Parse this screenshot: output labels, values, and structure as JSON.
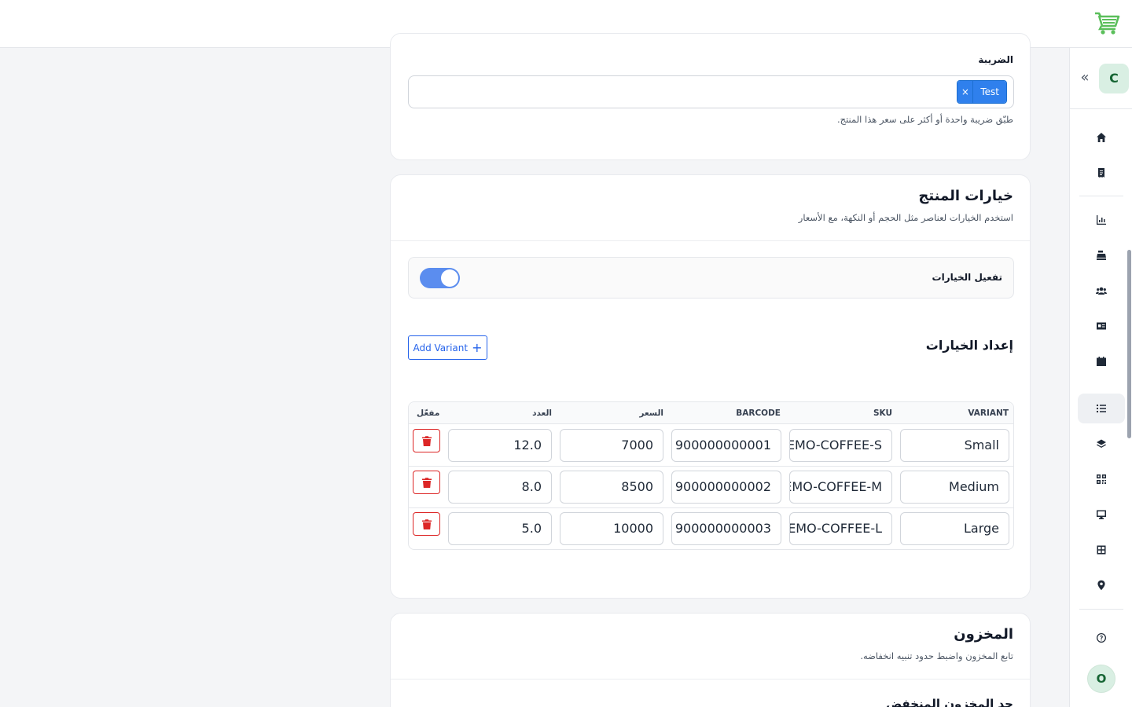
{
  "tax_section": {
    "label": "الضريبة",
    "selected_tags": [
      {
        "label": "Test",
        "remove": "×"
      }
    ],
    "help": "طبّق ضريبة واحدة أو أكثر على سعر هذا المنتج."
  },
  "options_section": {
    "title": "خيارات المنتج",
    "subtitle": "استخدم الخيارات لعناصر مثل الحجم أو النكهة، مع الأسعار",
    "enable_label": "تفعيل الخيارات",
    "enabled": true,
    "setup_title": "إعداد الخيارات",
    "add_button": "Add Variant",
    "columns": {
      "variant": "VARIANT",
      "sku": "SKU",
      "barcode": "BARCODE",
      "price": "السعر",
      "qty": "العدد",
      "enabled": "مفعّل"
    },
    "rows": [
      {
        "variant": "Small",
        "sku": "DEMO-COFFEE-S",
        "barcode": "900000000001",
        "price": "7000",
        "qty": "12.0"
      },
      {
        "variant": "Medium",
        "sku": "DEMO-COFFEE-M",
        "barcode": "900000000002",
        "price": "8500",
        "qty": "8.0"
      },
      {
        "variant": "Large",
        "sku": "DEMO-COFFEE-L",
        "barcode": "900000000003",
        "price": "10000",
        "qty": "5.0"
      }
    ]
  },
  "inventory_section": {
    "title": "المخزون",
    "subtitle": "تابع المخزون واضبط حدود تنبيه انخفاضه.",
    "low_stock_label": "حد المخزون المنخفض"
  },
  "sidebar": {
    "company_initial": "C",
    "user_initial": "O",
    "icons": [
      "home-icon",
      "receipt-icon",
      "chart-icon",
      "cash-register-icon",
      "users-icon",
      "id-card-icon",
      "calendar-icon",
      "list-icon",
      "layers-icon",
      "qr-code-icon",
      "monitor-icon",
      "table-grid-icon",
      "location-pin-icon",
      "help-icon"
    ]
  },
  "colors": {
    "brand_green": "#5bbf5b",
    "accent_blue": "#2f80ed",
    "toggle_on": "#5b8def",
    "danger": "#dc2626"
  }
}
